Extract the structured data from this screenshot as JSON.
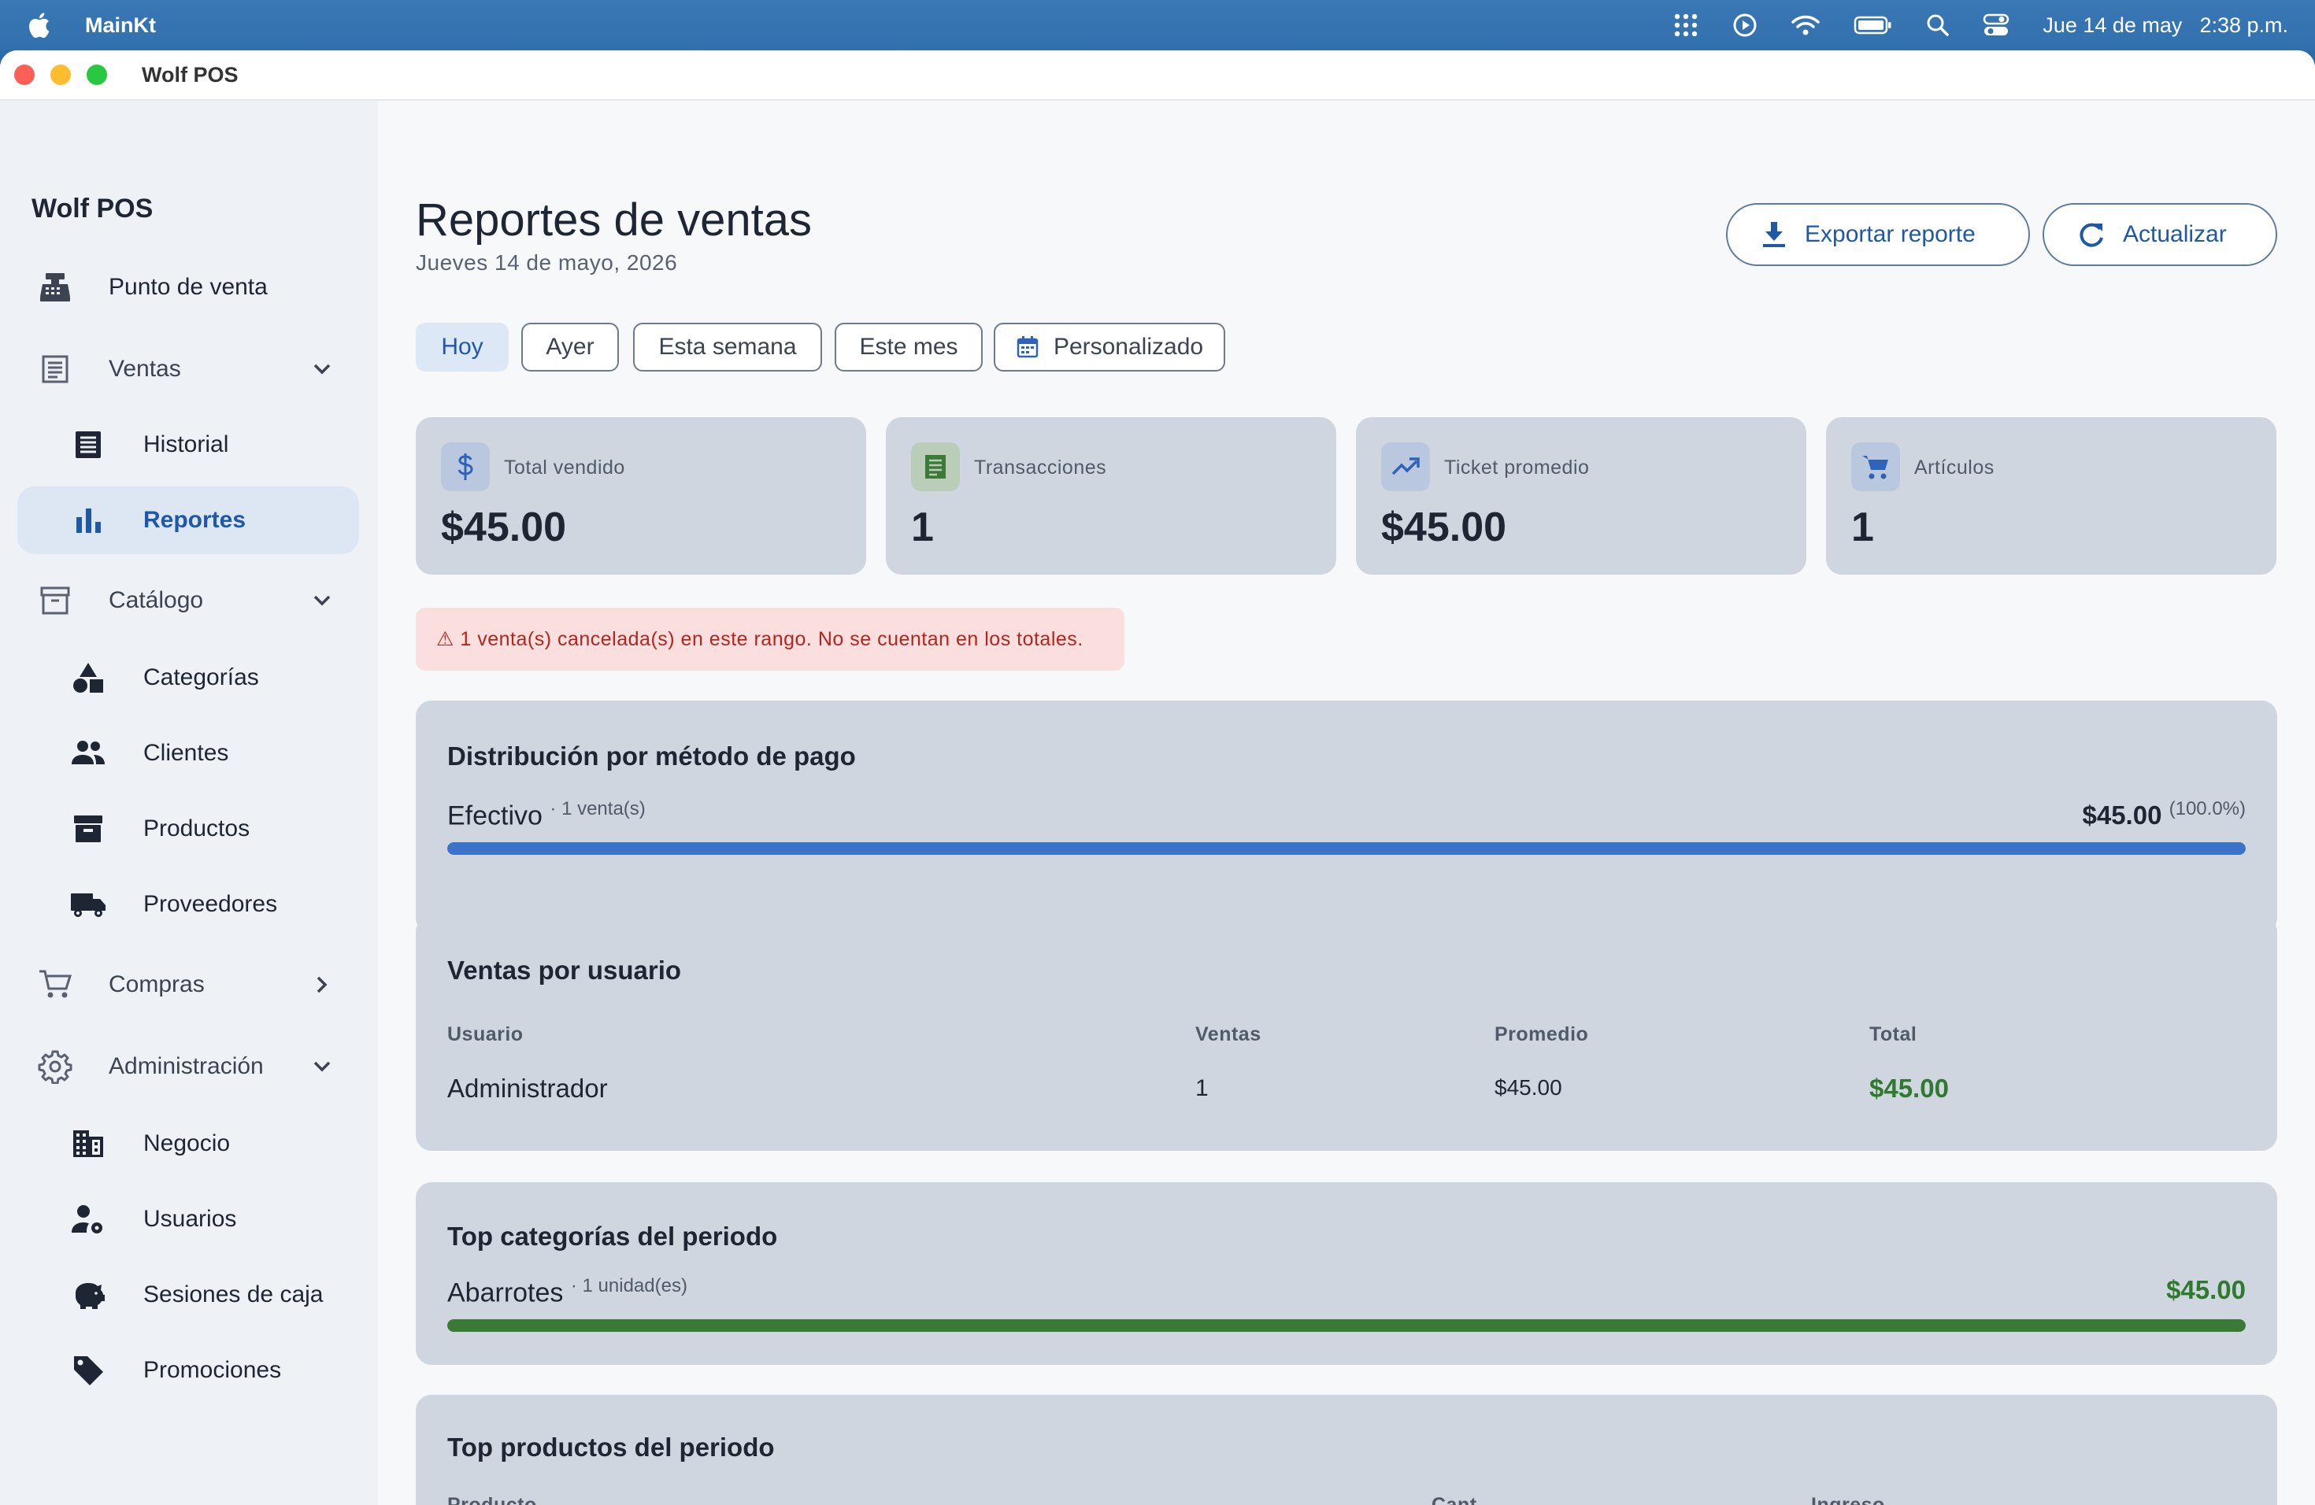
{
  "menubar": {
    "app_name": "MainKt",
    "date": "Jue 14 de may",
    "time": "2:38 p.m."
  },
  "window": {
    "title": "Wolf POS"
  },
  "sidebar": {
    "brand": "Wolf POS",
    "items": [
      {
        "label": "Punto de venta",
        "icon": "cash-register-icon"
      },
      {
        "label": "Ventas",
        "icon": "receipt-list-icon",
        "expanded": true
      },
      {
        "label": "Historial",
        "icon": "receipt-icon"
      },
      {
        "label": "Reportes",
        "icon": "bar-chart-icon",
        "active": true
      },
      {
        "label": "Catálogo",
        "icon": "archive-box-icon",
        "expanded": true
      },
      {
        "label": "Categorías",
        "icon": "shapes-icon"
      },
      {
        "label": "Clientes",
        "icon": "people-icon"
      },
      {
        "label": "Productos",
        "icon": "inventory-box-icon"
      },
      {
        "label": "Proveedores",
        "icon": "truck-icon"
      },
      {
        "label": "Compras",
        "icon": "shopping-cart-icon",
        "expanded": false
      },
      {
        "label": "Administración",
        "icon": "gear-icon",
        "expanded": true
      },
      {
        "label": "Negocio",
        "icon": "building-icon"
      },
      {
        "label": "Usuarios",
        "icon": "user-gear-icon"
      },
      {
        "label": "Sesiones de caja",
        "icon": "piggy-bank-icon"
      },
      {
        "label": "Promociones",
        "icon": "tag-icon"
      }
    ]
  },
  "header": {
    "title": "Reportes de ventas",
    "date": "Jueves 14 de mayo, 2026",
    "export_label": "Exportar reporte",
    "refresh_label": "Actualizar"
  },
  "filters": {
    "selected": "Hoy",
    "options": [
      "Hoy",
      "Ayer",
      "Esta semana",
      "Este mes",
      "Personalizado"
    ]
  },
  "stats": [
    {
      "label": "Total vendido",
      "value": "$45.00",
      "icon": "dollar-icon",
      "accent": "#2f63b8"
    },
    {
      "label": "Transacciones",
      "value": "1",
      "icon": "receipt-icon",
      "accent": "#3d7a3a"
    },
    {
      "label": "Ticket promedio",
      "value": "$45.00",
      "icon": "trending-up-icon",
      "accent": "#2f63b8"
    },
    {
      "label": "Artículos",
      "value": "1",
      "icon": "cart-icon",
      "accent": "#2f63b8"
    }
  ],
  "warning": "⚠ 1 venta(s) cancelada(s) en este rango. No se cuentan en los totales.",
  "payment_distribution": {
    "title": "Distribución por método de pago",
    "rows": [
      {
        "method": "Efectivo",
        "count": "· 1 venta(s)",
        "amount": "$45.00",
        "percent_label": "(100.0%)",
        "fraction": 1.0,
        "color": "#3b73c9"
      }
    ]
  },
  "sales_by_user": {
    "title": "Ventas por usuario",
    "headers": {
      "user": "Usuario",
      "sales": "Ventas",
      "avg": "Promedio",
      "total": "Total"
    },
    "rows": [
      {
        "user": "Administrador",
        "sales": "1",
        "avg": "$45.00",
        "total": "$45.00"
      }
    ]
  },
  "top_categories": {
    "title": "Top categorías del periodo",
    "rows": [
      {
        "name": "Abarrotes",
        "units": "· 1 unidad(es)",
        "amount": "$45.00",
        "fraction": 1.0,
        "color": "#3a7a36"
      }
    ]
  },
  "top_products": {
    "title": "Top productos del periodo",
    "headers": {
      "product": "Producto",
      "qty": "Cant.",
      "revenue": "Ingreso"
    }
  }
}
